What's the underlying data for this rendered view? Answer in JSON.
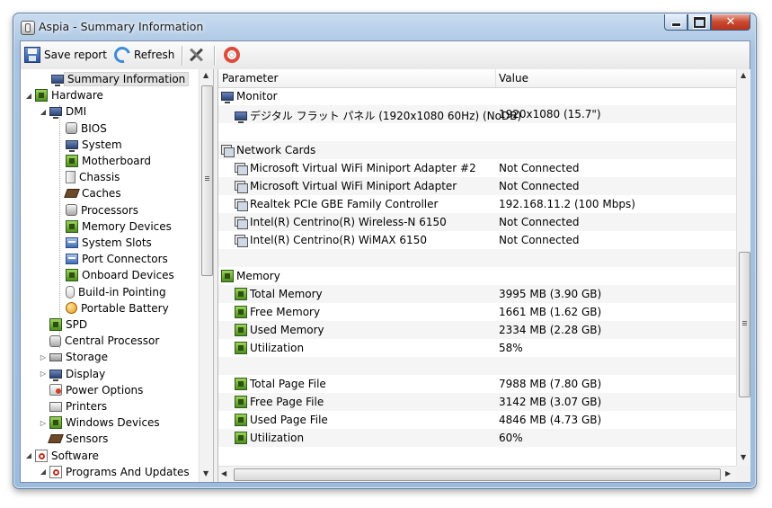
{
  "window": {
    "title": "Aspia - Summary Information",
    "close_glyph": "✕"
  },
  "toolbar": {
    "save_label": "Save report",
    "refresh_label": "Refresh"
  },
  "tree": {
    "items": [
      {
        "label": "Summary Information",
        "icon": "monitor-icon"
      },
      {
        "label": "Hardware",
        "icon": "chip-icon"
      },
      {
        "label": "DMI",
        "icon": "monitor-icon"
      },
      {
        "label": "BIOS",
        "icon": "gray-device-icon"
      },
      {
        "label": "System",
        "icon": "monitor-icon"
      },
      {
        "label": "Motherboard",
        "icon": "chip-icon"
      },
      {
        "label": "Chassis",
        "icon": "chassis-icon"
      },
      {
        "label": "Caches",
        "icon": "cache-icon"
      },
      {
        "label": "Processors",
        "icon": "gray-device-icon"
      },
      {
        "label": "Memory Devices",
        "icon": "chip-icon"
      },
      {
        "label": "System Slots",
        "icon": "blue-device-icon"
      },
      {
        "label": "Port Connectors",
        "icon": "blue-device-icon"
      },
      {
        "label": "Onboard Devices",
        "icon": "chip-icon"
      },
      {
        "label": "Build-in Pointing",
        "icon": "mouse-icon"
      },
      {
        "label": "Portable Battery",
        "icon": "battery-icon"
      },
      {
        "label": "SPD",
        "icon": "chip-icon"
      },
      {
        "label": "Central Processor",
        "icon": "gray-device-icon"
      },
      {
        "label": "Storage",
        "icon": "drive-icon"
      },
      {
        "label": "Display",
        "icon": "monitor-icon"
      },
      {
        "label": "Power Options",
        "icon": "power-icon"
      },
      {
        "label": "Printers",
        "icon": "printer-icon"
      },
      {
        "label": "Windows Devices",
        "icon": "chip-icon"
      },
      {
        "label": "Sensors",
        "icon": "cache-icon"
      },
      {
        "label": "Software",
        "icon": "software-icon"
      },
      {
        "label": "Programs And Updates",
        "icon": "software-icon"
      }
    ]
  },
  "list": {
    "col_parameter": "Parameter",
    "col_value": "Value",
    "rows": [
      {
        "param": "Monitor",
        "value": ""
      },
      {
        "param": "デジタル フラット パネル (1920x1080 60Hz) (NoDB)",
        "value": "1920x1080 (15.7\")"
      },
      {
        "param": "",
        "value": ""
      },
      {
        "param": "Network Cards",
        "value": ""
      },
      {
        "param": "Microsoft Virtual WiFi Miniport Adapter #2",
        "value": "Not Connected"
      },
      {
        "param": "Microsoft Virtual WiFi Miniport Adapter",
        "value": "Not Connected"
      },
      {
        "param": "Realtek PCIe GBE Family Controller",
        "value": "192.168.11.2 (100 Mbps)"
      },
      {
        "param": "Intel(R) Centrino(R) Wireless-N 6150",
        "value": "Not Connected"
      },
      {
        "param": "Intel(R) Centrino(R) WiMAX 6150",
        "value": "Not Connected"
      },
      {
        "param": "",
        "value": ""
      },
      {
        "param": "Memory",
        "value": ""
      },
      {
        "param": "Total Memory",
        "value": "3995 MB (3.90 GB)"
      },
      {
        "param": "Free Memory",
        "value": "1661 MB (1.62 GB)"
      },
      {
        "param": "Used Memory",
        "value": "2334 MB (2.28 GB)"
      },
      {
        "param": "Utilization",
        "value": "58%"
      },
      {
        "param": "",
        "value": ""
      },
      {
        "param": "Total Page File",
        "value": "7988 MB (7.80 GB)"
      },
      {
        "param": "Free Page File",
        "value": "3142 MB (3.07 GB)"
      },
      {
        "param": "Used Page File",
        "value": "4846 MB (4.73 GB)"
      },
      {
        "param": "Utilization",
        "value": "60%"
      }
    ]
  }
}
